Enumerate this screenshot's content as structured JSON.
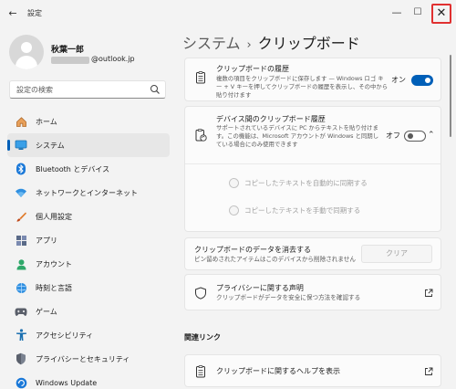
{
  "window": {
    "title": "設定",
    "back_glyph": "←",
    "min_glyph": "—",
    "max_glyph": "☐",
    "close_glyph": "✕"
  },
  "profile": {
    "name": "秋葉一郎",
    "email_suffix": "@outlook.jp"
  },
  "search": {
    "placeholder": "設定の検索",
    "icon": "search-icon"
  },
  "nav": {
    "items": [
      {
        "label": "ホーム",
        "icon": "home-icon"
      },
      {
        "label": "システム",
        "icon": "system-icon",
        "active": true
      },
      {
        "label": "Bluetooth とデバイス",
        "icon": "bluetooth-icon"
      },
      {
        "label": "ネットワークとインターネット",
        "icon": "network-icon"
      },
      {
        "label": "個人用設定",
        "icon": "personalization-icon"
      },
      {
        "label": "アプリ",
        "icon": "apps-icon"
      },
      {
        "label": "アカウント",
        "icon": "account-icon"
      },
      {
        "label": "時刻と言語",
        "icon": "time-language-icon"
      },
      {
        "label": "ゲーム",
        "icon": "gaming-icon"
      },
      {
        "label": "アクセシビリティ",
        "icon": "accessibility-icon"
      },
      {
        "label": "プライバシーとセキュリティ",
        "icon": "privacy-security-icon"
      },
      {
        "label": "Windows Update",
        "icon": "windows-update-icon"
      }
    ]
  },
  "breadcrumb": {
    "parent": "システム",
    "separator": "›",
    "current": "クリップボード"
  },
  "clipboard_history": {
    "title": "クリップボードの履歴",
    "desc": "複数の項目をクリップボードに保存します — Windows ロゴ キー + V キーを押してクリップボードの履歴を表示し、その中から貼り付けます",
    "toggle_label": "オン",
    "toggle_on": true
  },
  "cross_device": {
    "title": "デバイス間のクリップボード履歴",
    "desc": "サポートされているデバイスに PC からテキストを貼り付けます。この機能は、Microsoft アカウントが Windows と同期している場合にのみ使用できます",
    "toggle_label": "オフ",
    "toggle_on": false,
    "chevron": "⌃",
    "options": [
      "コピーしたテキストを自動的に同期する",
      "コピーしたテキストを手動で同期する"
    ]
  },
  "clear_data": {
    "title": "クリップボードのデータを消去する",
    "desc": "ピン留めされたアイテムはこのデバイスから削除されません",
    "button_label": "クリア"
  },
  "privacy_statement": {
    "title": "プライバシーに関する声明",
    "desc": "クリップボードがデータを安全に保つ方法を確認する"
  },
  "related": {
    "heading": "関連リンク",
    "help_link": "クリップボードに関するヘルプを表示"
  },
  "colors": {
    "accent": "#005fb8",
    "close_highlight": "#e03030"
  }
}
